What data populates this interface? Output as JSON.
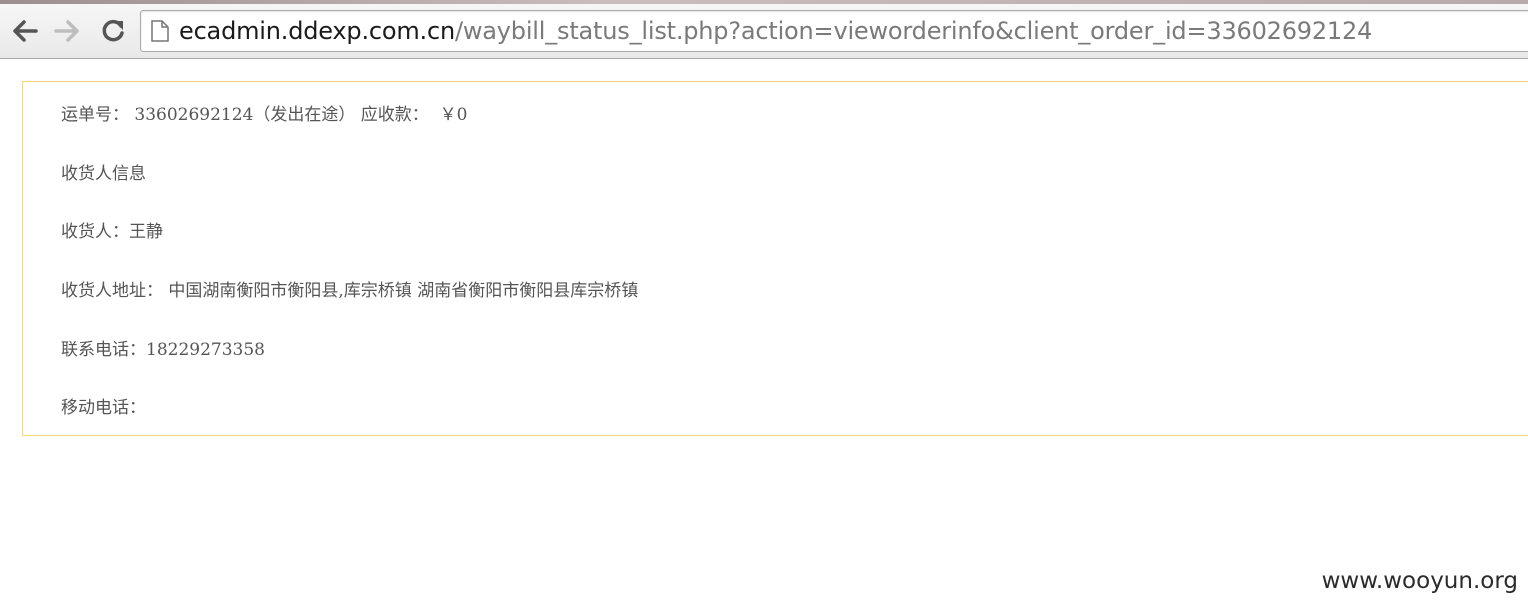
{
  "browser": {
    "url_host": "ecadmin.ddexp.com.cn",
    "url_path": "/waybill_status_list.php?action=vieworderinfo&client_order_id=33602692124",
    "icons": {
      "back": "back-arrow-icon",
      "forward": "forward-arrow-icon",
      "reload": "reload-icon",
      "page": "page-icon"
    }
  },
  "order": {
    "waybill_label": "运单号：",
    "waybill_number": "33602692124（发出在途）",
    "receivable_label": "应收款：",
    "receivable_value": "￥0",
    "section_title": "收货人信息",
    "consignee_label": "收货人：",
    "consignee_name": "王静",
    "address_label": "收货人地址：",
    "address_value": "中国湖南衡阳市衡阳县,库宗桥镇 湖南省衡阳市衡阳县库宗桥镇",
    "phone_label": "联系电话：",
    "phone_value": "18229273358",
    "mobile_label": "移动电话：",
    "mobile_value": ""
  },
  "watermark": "www.wooyun.org",
  "colors": {
    "box_border": "#f5d77a",
    "text": "#555555"
  }
}
